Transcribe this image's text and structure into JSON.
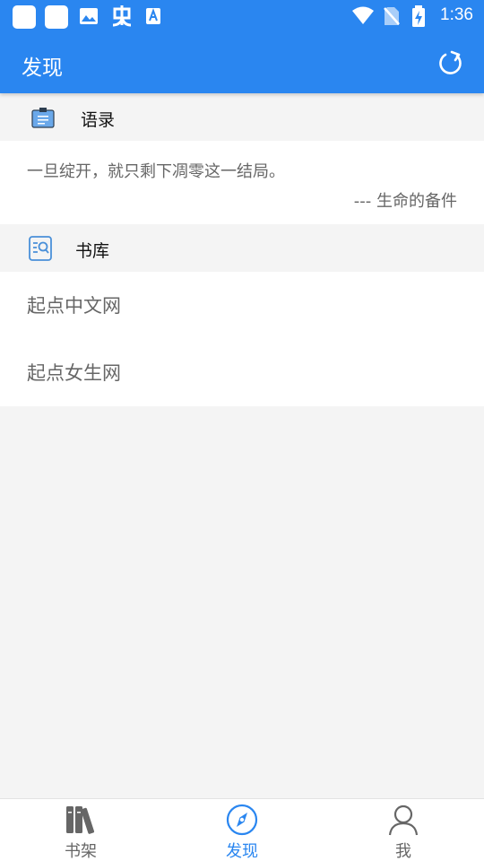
{
  "status_bar": {
    "time": "1:36",
    "left_icons": [
      "app-icon",
      "app-icon",
      "image-icon",
      "notification-icon",
      "font-icon"
    ],
    "right_icons": [
      "wifi-icon",
      "no-sim-icon",
      "battery-charging-icon"
    ]
  },
  "app_bar": {
    "title": "发现",
    "action_icon": "refresh-icon"
  },
  "quotes_section": {
    "header": "语录",
    "icon": "clipboard-icon",
    "quote": "一旦绽开，就只剩下凋零这一结局。",
    "source": "--- 生命的备件"
  },
  "library_section": {
    "header": "书库",
    "icon": "book-search-icon",
    "items": [
      {
        "label": "起点中文网"
      },
      {
        "label": "起点女生网"
      }
    ]
  },
  "bottom_nav": {
    "items": [
      {
        "label": "书架",
        "icon": "bookshelf-icon",
        "active": false
      },
      {
        "label": "发现",
        "icon": "compass-icon",
        "active": true
      },
      {
        "label": "我",
        "icon": "person-icon",
        "active": false
      }
    ]
  },
  "colors": {
    "primary": "#2a86f0",
    "background": "#f4f4f4",
    "card": "#ffffff",
    "text_secondary": "#666666"
  }
}
